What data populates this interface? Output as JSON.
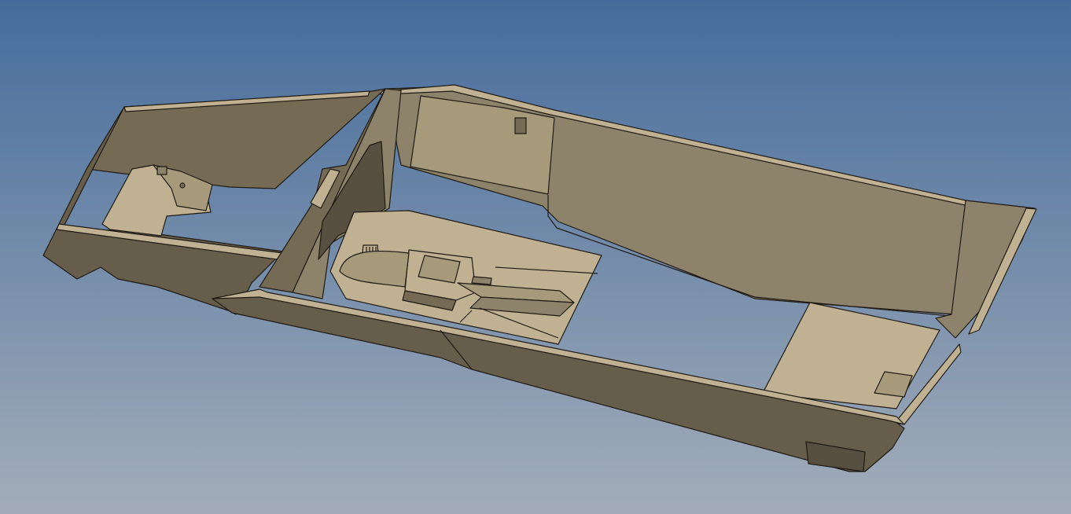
{
  "viewport": {
    "background": {
      "top_color": "#456c9c",
      "bottom_color": "#a3adb9"
    },
    "model": {
      "colors": {
        "edge": "#1f1b14",
        "light_face": "#bfb191",
        "mid_face": "#a69a7b",
        "wall_face": "#8d826a",
        "dark_face": "#756b55",
        "shadow_face": "#665d4b",
        "deep_shadow": "#574f3f"
      }
    }
  }
}
